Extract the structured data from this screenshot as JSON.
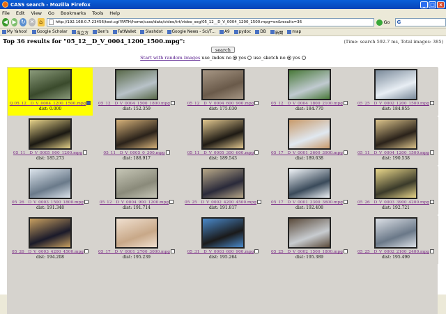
{
  "window": {
    "title": "CASS search - Mozilla Firefox"
  },
  "menu": [
    "File",
    "Edit",
    "View",
    "Go",
    "Bookmarks",
    "Tools",
    "Help"
  ],
  "url": "http://192.168.0.7:23456/test.cgi?PATH/home/cass/data/video/trt/video_seg/05_12__D_V_0004_1200_1500.mpg=on&results=36",
  "go_label": "Go",
  "search_box": "G",
  "bookmarks": [
    "My Yahoo!",
    "Google Scholar",
    "海立方",
    "Ben's",
    "FatWallet",
    "Slashdot",
    "Google News - Sci/T...",
    "A9",
    "pydoc",
    "DB",
    "新聞",
    "map"
  ],
  "header": {
    "title": "Top 36 results for \"05_12__D_V_0004_1200_1500.mpg\":",
    "timing": "(Time: search 592.7 ms, Total images: 385)"
  },
  "controls": {
    "search_label": "search",
    "random_link": "Start with random images",
    "use_index_label": "use_index",
    "use_sketch_label": "use_sketch",
    "no": "no",
    "yes": "yes"
  },
  "results": [
    {
      "name": "Q 05_12__D_V_0004_1200_1500.mpg",
      "dist": "dist: 0.000",
      "selected": true,
      "c1": "#3a4a2c",
      "c2": "#8a9a7a"
    },
    {
      "name": "05_12__D_V_0004_1500_1800.mpg",
      "dist": "dist: 152.359",
      "selected": false,
      "c1": "#b8c2c8",
      "c2": "#5a6a4a"
    },
    {
      "name": "05_12__D_V_0004_600_900.mpg",
      "dist": "dist: 175.030",
      "selected": false,
      "c1": "#6a5a4a",
      "c2": "#a69684"
    },
    {
      "name": "05_12__D_V_0004_1800_2100.mpg",
      "dist": "dist: 184.770",
      "selected": false,
      "c1": "#c0cad0",
      "c2": "#4a7a3a"
    },
    {
      "name": "05_25__D_V_0002_1200_1500.mpg",
      "dist": "dist: 184.955",
      "selected": false,
      "c1": "#e8eef4",
      "c2": "#7a8a9a"
    },
    {
      "name": "05_11__D_V_0005_900_1200.mpg",
      "dist": "dist: 185.273",
      "selected": false,
      "c1": "#1a1812",
      "c2": "#e6d28a"
    },
    {
      "name": "05_11__D_V_0005_0_300.mpg",
      "dist": "dist: 188.917",
      "selected": false,
      "c1": "#2a221a",
      "c2": "#d6b27a"
    },
    {
      "name": "05_11__D_V_0005_300_600.mpg",
      "dist": "dist: 189.543",
      "selected": false,
      "c1": "#1e1a14",
      "c2": "#e2c890"
    },
    {
      "name": "05_17__D_V_0001_3600_3900.mpg",
      "dist": "dist: 189.638",
      "selected": false,
      "c1": "#e0e8f0",
      "c2": "#c89a6a"
    },
    {
      "name": "05_11__D_V_0004_1200_1500.mpg",
      "dist": "dist: 190.538",
      "selected": false,
      "c1": "#2a221a",
      "c2": "#dcc48c"
    },
    {
      "name": "05_26__D_V_0003_1500_1800.mpg",
      "dist": "dist: 191.348",
      "selected": false,
      "c1": "#6a7a8a",
      "c2": "#dce4ec"
    },
    {
      "name": "05_12__D_V_0004_900_1200.mpg",
      "dist": "dist: 191.714",
      "selected": false,
      "c1": "#8a8a7a",
      "c2": "#c6c6b6"
    },
    {
      "name": "05_25__D_V_0002_4200_4500.mpg",
      "dist": "dist: 191.817",
      "selected": false,
      "c1": "#2a2a3a",
      "c2": "#b8a888"
    },
    {
      "name": "05_17__D_V_0001_3300_3600.mpg",
      "dist": "dist: 192.408",
      "selected": false,
      "c1": "#3a4a5a",
      "c2": "#f0f4f8"
    },
    {
      "name": "05_26__D_V_0003_3900_4200.mpg",
      "dist": "dist: 192.721",
      "selected": false,
      "c1": "#3a3a2a",
      "c2": "#e8d68a"
    },
    {
      "name": "05_26__D_V_0003_4200_4500.mpg",
      "dist": "dist: 194.208",
      "selected": false,
      "c1": "#1a1a2a",
      "c2": "#c8a060"
    },
    {
      "name": "05_17__D_V_0001_2700_3000.mpg",
      "dist": "dist: 195.239",
      "selected": false,
      "c1": "#c8a888",
      "c2": "#f0e0d0"
    },
    {
      "name": "05_31__D_V_0003_600_900.mpg",
      "dist": "dist: 195.264",
      "selected": false,
      "c1": "#1a1a1a",
      "c2": "#4a8acb"
    },
    {
      "name": "05_25__D_V_0002_1500_1800.mpg",
      "dist": "dist: 195.389",
      "selected": false,
      "c1": "#c8ccd0",
      "c2": "#5a4a3a"
    },
    {
      "name": "05_25__D_V_0002_2100_2400.mpg",
      "dist": "dist: 195.490",
      "selected": false,
      "c1": "#6a7888",
      "c2": "#dce0e6"
    }
  ]
}
